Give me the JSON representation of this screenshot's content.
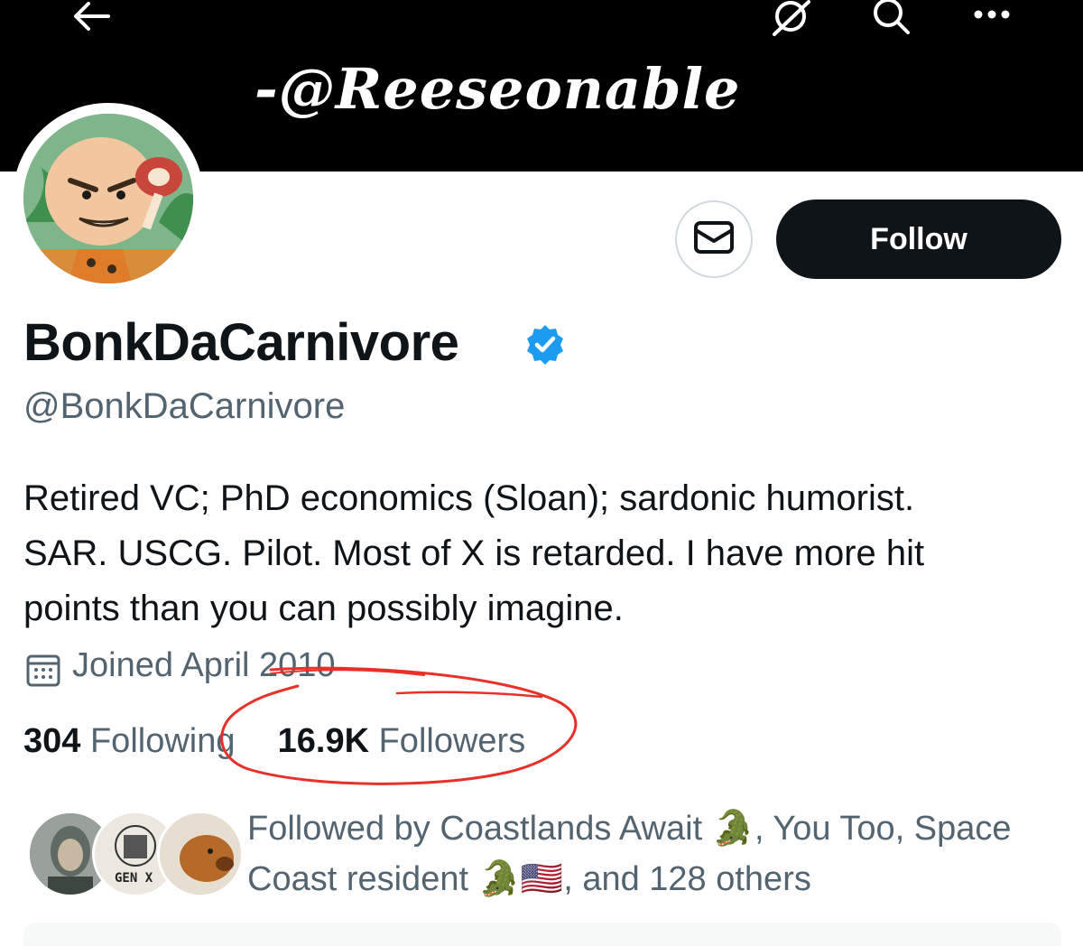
{
  "banner": {
    "text": "-@Reeseonable"
  },
  "header": {
    "back_icon": "arrow-left-icon",
    "grok_icon": "grok-icon",
    "search_icon": "search-icon",
    "more_icon": "more-icon"
  },
  "profile": {
    "display_name": "BonkDaCarnivore",
    "handle": "@BonkDaCarnivore",
    "verified": true,
    "bio_lines": [
      "Retired VC; PhD economics (Sloan); sardonic humorist.",
      "SAR. USCG. Pilot. Most of X is retarded. I have more hit",
      "points than you can possibly imagine."
    ],
    "joined": "Joined April 2010"
  },
  "actions": {
    "follow_label": "Follow",
    "message_icon": "envelope-icon"
  },
  "stats": {
    "following_count": "304",
    "following_label": "Following",
    "followers_count": "16.9K",
    "followers_label": "Followers"
  },
  "followers_you_know": {
    "line1": "Followed by Coastlands Await 🐊, You Too, Space",
    "line2": "Coast resident 🐊🇺🇸, and 128 others",
    "avatar_badge_text": "GEN X"
  },
  "colors": {
    "text_primary": "#0f1419",
    "text_secondary": "#536471",
    "verified_blue": "#1d9bf0",
    "annotation_red": "#e8302a",
    "banner": "#000000"
  }
}
